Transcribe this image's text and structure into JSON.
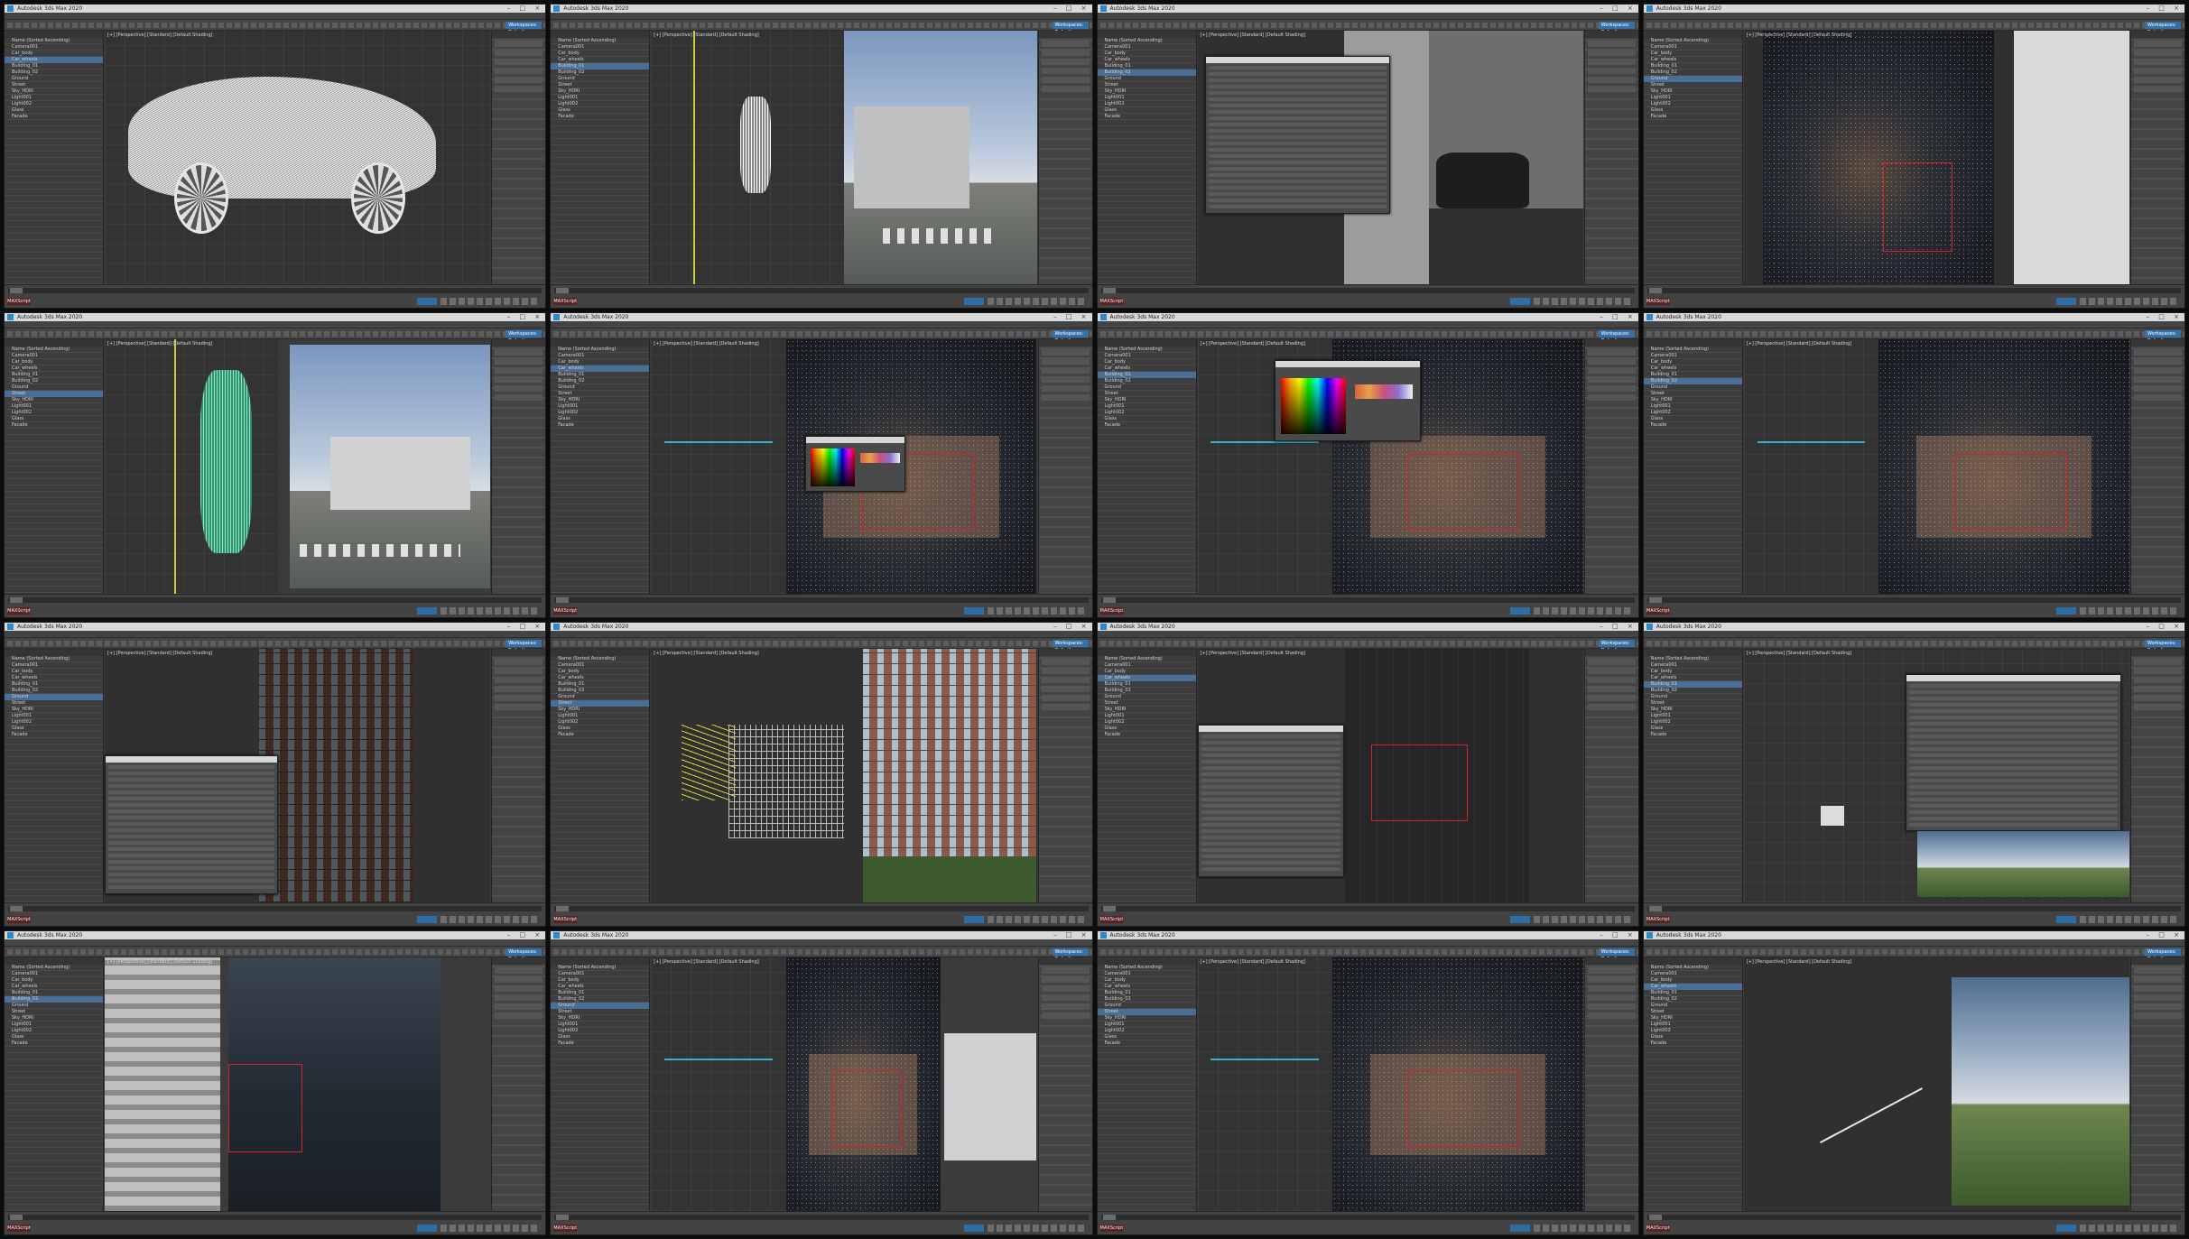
{
  "app": {
    "tile_title": "Autodesk 3ds Max 2020",
    "menus": [
      "File",
      "Edit",
      "Tools",
      "Group",
      "Views",
      "Create",
      "Modifiers",
      "Animation",
      "Graph Editors",
      "Rendering",
      "Civil View",
      "Customize",
      "Scripting",
      "Interactive",
      "Content",
      "Arnold",
      "Help"
    ],
    "workspace_label": "Workspaces: Default",
    "status_text": "",
    "maxscript_label": "MAXScript",
    "viewport_label": "[+] [Perspective] [Standard] [Default Shading]"
  },
  "tiles": [
    {
      "id": 1,
      "content": "car-wireframe"
    },
    {
      "id": 2,
      "content": "car-top-and-street"
    },
    {
      "id": 3,
      "content": "material-editor-and-car-front"
    },
    {
      "id": 4,
      "content": "night-render-with-car"
    },
    {
      "id": 5,
      "content": "green-car-top-and-daylight-building"
    },
    {
      "id": 6,
      "content": "color-picker-over-night-render"
    },
    {
      "id": 7,
      "content": "color-picker-large-over-night-render"
    },
    {
      "id": 8,
      "content": "blueprint-and-night-render"
    },
    {
      "id": 9,
      "content": "slate-editor-and-brick-building-night"
    },
    {
      "id": 10,
      "content": "wire-building-and-brick-render"
    },
    {
      "id": 11,
      "content": "material-nodes-dark-render"
    },
    {
      "id": 12,
      "content": "node-editor-and-field-render"
    },
    {
      "id": 13,
      "content": "facade-and-dark-render"
    },
    {
      "id": 14,
      "content": "night-render-and-white-model"
    },
    {
      "id": 15,
      "content": "night-render-wire"
    },
    {
      "id": 16,
      "content": "streetlight-field-render"
    }
  ],
  "scene_explorer_rows": [
    "Name (Sorted Ascending)",
    "Camera001",
    "Car_body",
    "Car_wheels",
    "Building_01",
    "Building_02",
    "Ground",
    "Street",
    "Sky_HDRI",
    "Light001",
    "Light002",
    "Glass",
    "Facade"
  ],
  "colors": {
    "ui_bg": "#3a3a3a",
    "accent_blue": "#2e88c9",
    "selection_red": "#d12424",
    "maxscript_red": "#5a2323"
  }
}
